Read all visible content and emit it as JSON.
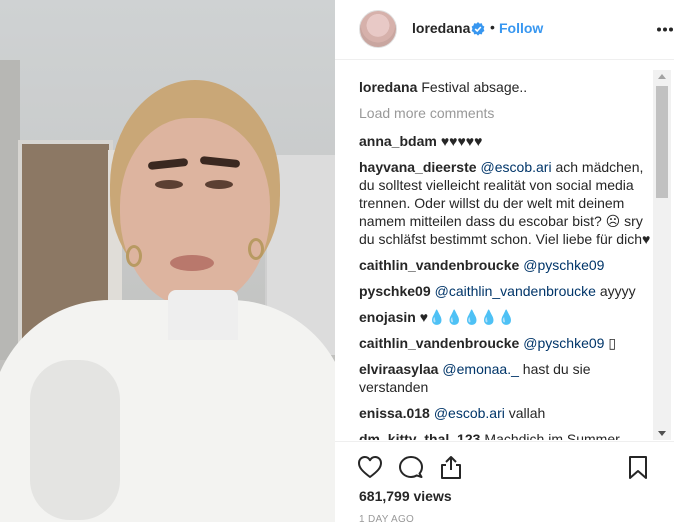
{
  "header": {
    "username": "loredana",
    "separator": "•",
    "follow_label": "Follow"
  },
  "comments": [
    {
      "user": "loredana",
      "text": "Festival absage.."
    },
    {
      "user": "anna_bdam",
      "text": "♥♥♥♥♥"
    },
    {
      "user": "hayvana_dieerste",
      "mention": "@escob.ari",
      "text": " ach mädchen, du solltest vielleicht realität von social media trennen. Oder willst du der welt mit deinem namem mitteilen dass du escobar bist? ☹ sry du schläfst bestimmt schon. Viel liebe für dich♥"
    },
    {
      "user": "caithlin_vandenbroucke",
      "mention": "@pyschke09",
      "text": ""
    },
    {
      "user": "pyschke09",
      "mention": "@caithlin_vandenbroucke",
      "text": " ayyyy"
    },
    {
      "user": "enojasin",
      "text": "♥💧💧💧💧💧"
    },
    {
      "user": "caithlin_vandenbroucke",
      "mention": "@pyschke09",
      "text": " ▯"
    },
    {
      "user": "elviraasylaa",
      "mention": "@emonaa._",
      "text": " hast du sie verstanden"
    },
    {
      "user": "enissa.018",
      "mention": "@escob.ari",
      "text": " vallah"
    },
    {
      "user": "dm_kitty_thal_123",
      "text": "Machdich im Summer"
    }
  ],
  "load_more_label": "Load more comments",
  "stats": {
    "views": "681,799 views",
    "timestamp": "1 DAY AGO"
  },
  "colors": {
    "accent": "#3897f0",
    "mention": "#003569",
    "muted": "#999999"
  },
  "icons": [
    "verified-icon",
    "more-icon",
    "heart-icon",
    "comment-icon",
    "share-icon",
    "bookmark-icon"
  ]
}
